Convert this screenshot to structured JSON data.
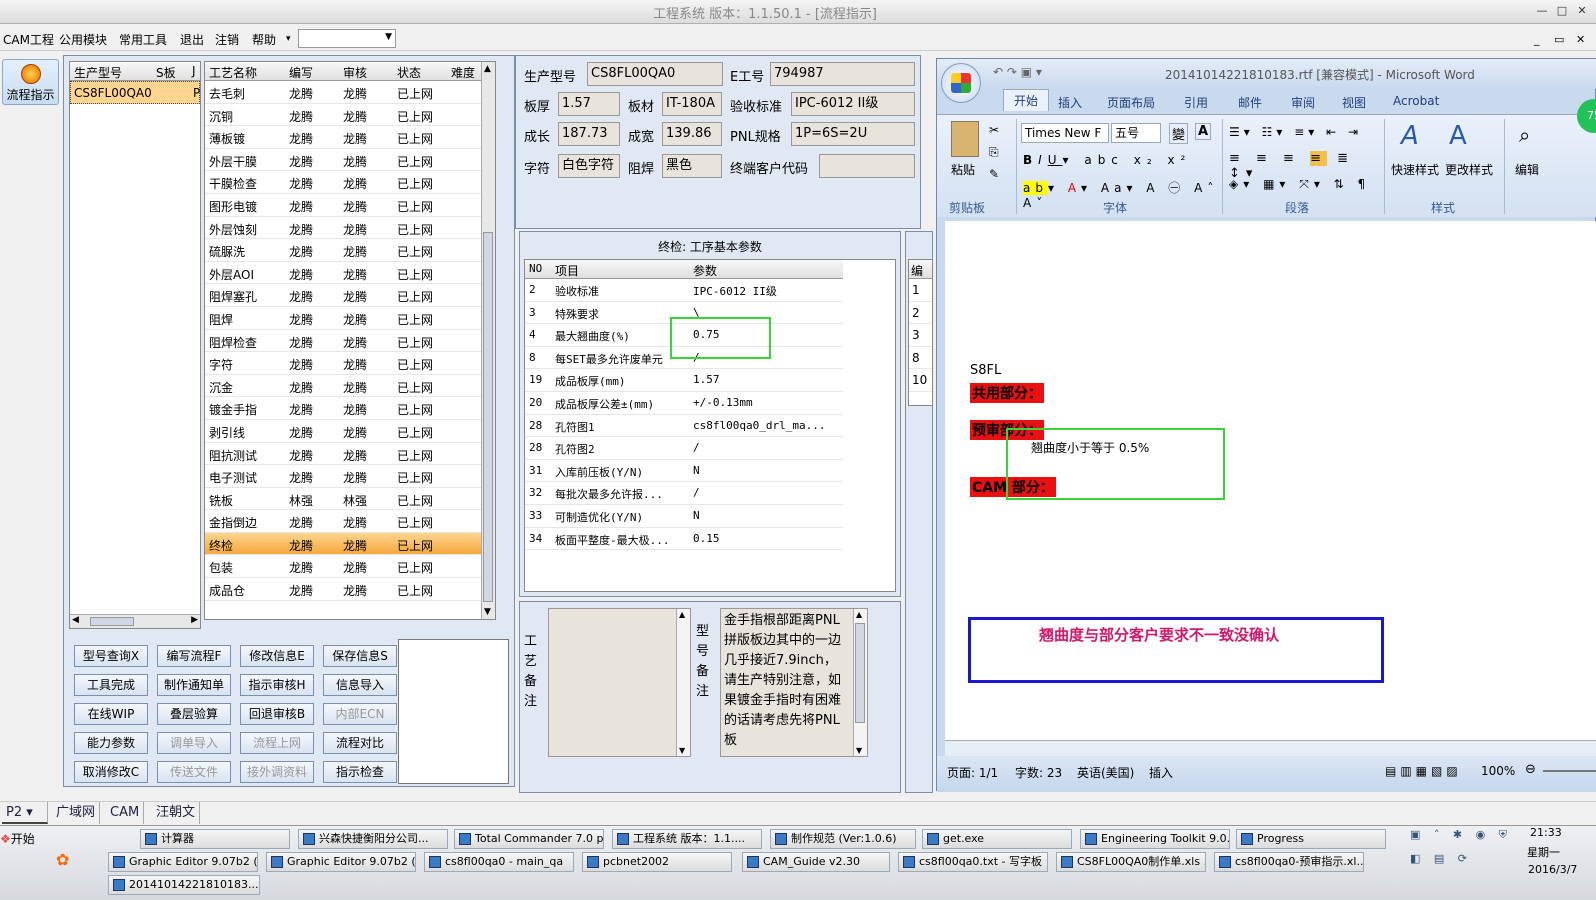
{
  "window": {
    "title": "工程系统  版本：1.1.50.1 - [流程指示]",
    "min": "—",
    "max": "□",
    "close": "✕"
  },
  "menu": {
    "items": [
      "CAM工程",
      "公用模块",
      "常用工具",
      "退出",
      "注销",
      "帮助"
    ],
    "combo": ""
  },
  "left_button": {
    "label": "流程指示"
  },
  "model_list": {
    "headers": [
      "生产型号",
      "S板",
      "J"
    ],
    "rows": [
      [
        "CS8FL00QA0",
        "P"
      ]
    ]
  },
  "process": {
    "headers": [
      "工艺名称",
      "编写",
      "审核",
      "状态",
      "难度"
    ],
    "rows": [
      [
        "去毛刺",
        "龙腾",
        "龙腾",
        "已上网"
      ],
      [
        "沉铜",
        "龙腾",
        "龙腾",
        "已上网"
      ],
      [
        "薄板镀",
        "龙腾",
        "龙腾",
        "已上网"
      ],
      [
        "外层干膜",
        "龙腾",
        "龙腾",
        "已上网"
      ],
      [
        "干膜检查",
        "龙腾",
        "龙腾",
        "已上网"
      ],
      [
        "图形电镀",
        "龙腾",
        "龙腾",
        "已上网"
      ],
      [
        "外层蚀刻",
        "龙腾",
        "龙腾",
        "已上网"
      ],
      [
        "硫脲洗",
        "龙腾",
        "龙腾",
        "已上网"
      ],
      [
        "外层AOI",
        "龙腾",
        "龙腾",
        "已上网"
      ],
      [
        "阻焊塞孔",
        "龙腾",
        "龙腾",
        "已上网"
      ],
      [
        "阻焊",
        "龙腾",
        "龙腾",
        "已上网"
      ],
      [
        "阻焊检查",
        "龙腾",
        "龙腾",
        "已上网"
      ],
      [
        "字符",
        "龙腾",
        "龙腾",
        "已上网"
      ],
      [
        "沉金",
        "龙腾",
        "龙腾",
        "已上网"
      ],
      [
        "镀金手指",
        "龙腾",
        "龙腾",
        "已上网"
      ],
      [
        "剥引线",
        "龙腾",
        "龙腾",
        "已上网"
      ],
      [
        "阻抗测试",
        "龙腾",
        "龙腾",
        "已上网"
      ],
      [
        "电子测试",
        "龙腾",
        "龙腾",
        "已上网"
      ],
      [
        "铣板",
        "林强",
        "林强",
        "已上网"
      ],
      [
        "金指倒边",
        "龙腾",
        "龙腾",
        "已上网"
      ],
      [
        "终检",
        "龙腾",
        "龙腾",
        "已上网"
      ],
      [
        "包装",
        "龙腾",
        "龙腾",
        "已上网"
      ],
      [
        "成品仓",
        "龙腾",
        "龙腾",
        "已上网"
      ]
    ],
    "selected": 20
  },
  "buttons": [
    [
      "型号查询X",
      "编写流程F",
      "修改信息E",
      "保存信息S"
    ],
    [
      "工具完成",
      "制作通知单",
      "指示审核H",
      "信息导入"
    ],
    [
      "在线WIP",
      "叠层验算",
      "回退审核B",
      "内部ECN"
    ],
    [
      "能力参数",
      "调单导入",
      "流程上网",
      "流程对比"
    ],
    [
      "取消修改C",
      "传送文件",
      "接外调资料",
      "指示检查"
    ]
  ],
  "disabled_buttons": [
    "内部ECN",
    "调单导入",
    "流程上网",
    "传送文件",
    "接外调资料"
  ],
  "info": {
    "prod_no_label": "生产型号",
    "prod_no": "CS8FL00QA0",
    "e_no_label": "E工号",
    "e_no": "794987",
    "thick_label": "板厚",
    "thick": "1.57",
    "material_label": "板材",
    "material": "IT-180A",
    "std_label": "验收标准",
    "std": "IPC-6012 II级",
    "len_label": "成长",
    "len": "187.73",
    "width_label": "成宽",
    "width": "139.86",
    "pnl_label": "PNL规格",
    "pnl": "1P=6S=2U",
    "char_label": "字符",
    "char": "白色字符",
    "mask_label": "阻焊",
    "mask": "黑色",
    "cust_label": "终端客户代码",
    "cust": ""
  },
  "params": {
    "title": "终检: 工序基本参数",
    "headers": [
      "NO",
      "项目",
      "参数"
    ],
    "rows": [
      [
        "2",
        "验收标准",
        "IPC-6012 II级"
      ],
      [
        "3",
        "特殊要求",
        "\\"
      ],
      [
        "4",
        "最大翘曲度(%)",
        "0.75"
      ],
      [
        "8",
        "每SET最多允许废单元",
        "/"
      ],
      [
        "19",
        "成品板厚(mm)",
        "1.57"
      ],
      [
        "20",
        "成品板厚公差±(mm)",
        "+/-0.13mm"
      ],
      [
        "28",
        "孔符图1",
        "cs8fl00qa0_drl_ma..."
      ],
      [
        "28",
        "孔符图2",
        "/"
      ],
      [
        "31",
        "入库前压板(Y/N)",
        "N"
      ],
      [
        "32",
        "每批次最多允许报...",
        "/"
      ],
      [
        "33",
        "可制造优化(Y/N)",
        "N"
      ],
      [
        "34",
        "板面平整度-最大极...",
        "0.15"
      ]
    ]
  },
  "side_table": {
    "header": "编号",
    "rows": [
      "1",
      "2",
      "3",
      "8",
      "10"
    ]
  },
  "notes": {
    "craft_label": "工艺备注",
    "model_label": "型号备注",
    "model_text": "金手指根部距离PNL拼版板边其中的一边几乎接近7.9inch，请生产特别注意，如果镀金手指时有困难的话请考虑先将PNL板"
  },
  "word": {
    "title": "20141014221810183.rtf [兼容模式] - Microsoft Word",
    "tabs": [
      "开始",
      "插入",
      "页面布局",
      "引用",
      "邮件",
      "审阅",
      "视图",
      "Acrobat"
    ],
    "font": "Times New F",
    "size": "五号",
    "groups": [
      "剪贴板",
      "字体",
      "段落",
      "样式"
    ],
    "paste": "粘贴",
    "quick_style": "快速样式",
    "change_style": "更改样式",
    "edit": "编辑",
    "doc": {
      "line1": "S8FL",
      "common": "共用部分：",
      "pre": "预审部分：",
      "warp": "翘曲度小于等于 0.5%",
      "cam": "CAM 部分："
    },
    "note_box": "翘曲度与部分客户要求不一致没确认",
    "status": {
      "page": "页面: 1/1",
      "words": "字数: 23",
      "lang": "英语(美国)",
      "mode": "插入",
      "zoom": "100%"
    },
    "badge": "75"
  },
  "bottom_tabs": [
    "P2",
    "广域网",
    "CAM",
    "汪朝文"
  ],
  "taskbar": {
    "start": "开始",
    "row1": [
      "计算器",
      "兴森快捷衡阳分公司...",
      "Total Commander 7.0 p...",
      "工程系统  版本：1.1....",
      "制作规范 (Ver:1.0.6)",
      "get.exe",
      "Engineering Toolkit 9.0...",
      "Progress"
    ],
    "row2": [
      "Graphic Editor 9.07b2 (0...",
      "Graphic Editor 9.07b2 (0...",
      "cs8fl00qa0 - main_qa",
      "pcbnet2002",
      "CAM_Guide v2.30",
      "cs8fl00qa0.txt - 写字板",
      "CS8FL00QA0制作单.xls ...",
      "cs8fl00qa0-预审指示.xl..."
    ],
    "row3": [
      "20141014221810183...."
    ],
    "clock": "21:33",
    "day": "星期一",
    "date": "2016/3/7"
  },
  "colors": {
    "accent": "#f5a83c",
    "green": "#35d635",
    "blue_box": "#1a1acc",
    "magenta": "#d0186a",
    "red_hl": "#e81010"
  }
}
